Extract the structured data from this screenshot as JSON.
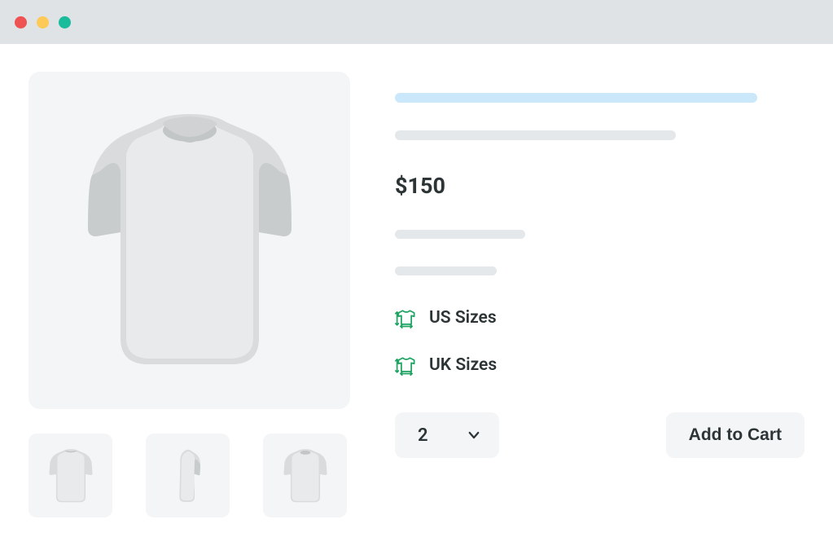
{
  "price": "$150",
  "sizes": {
    "us_label": "US Sizes",
    "uk_label": "UK Sizes"
  },
  "quantity": {
    "value": "2"
  },
  "actions": {
    "add_to_cart": "Add to Cart"
  }
}
